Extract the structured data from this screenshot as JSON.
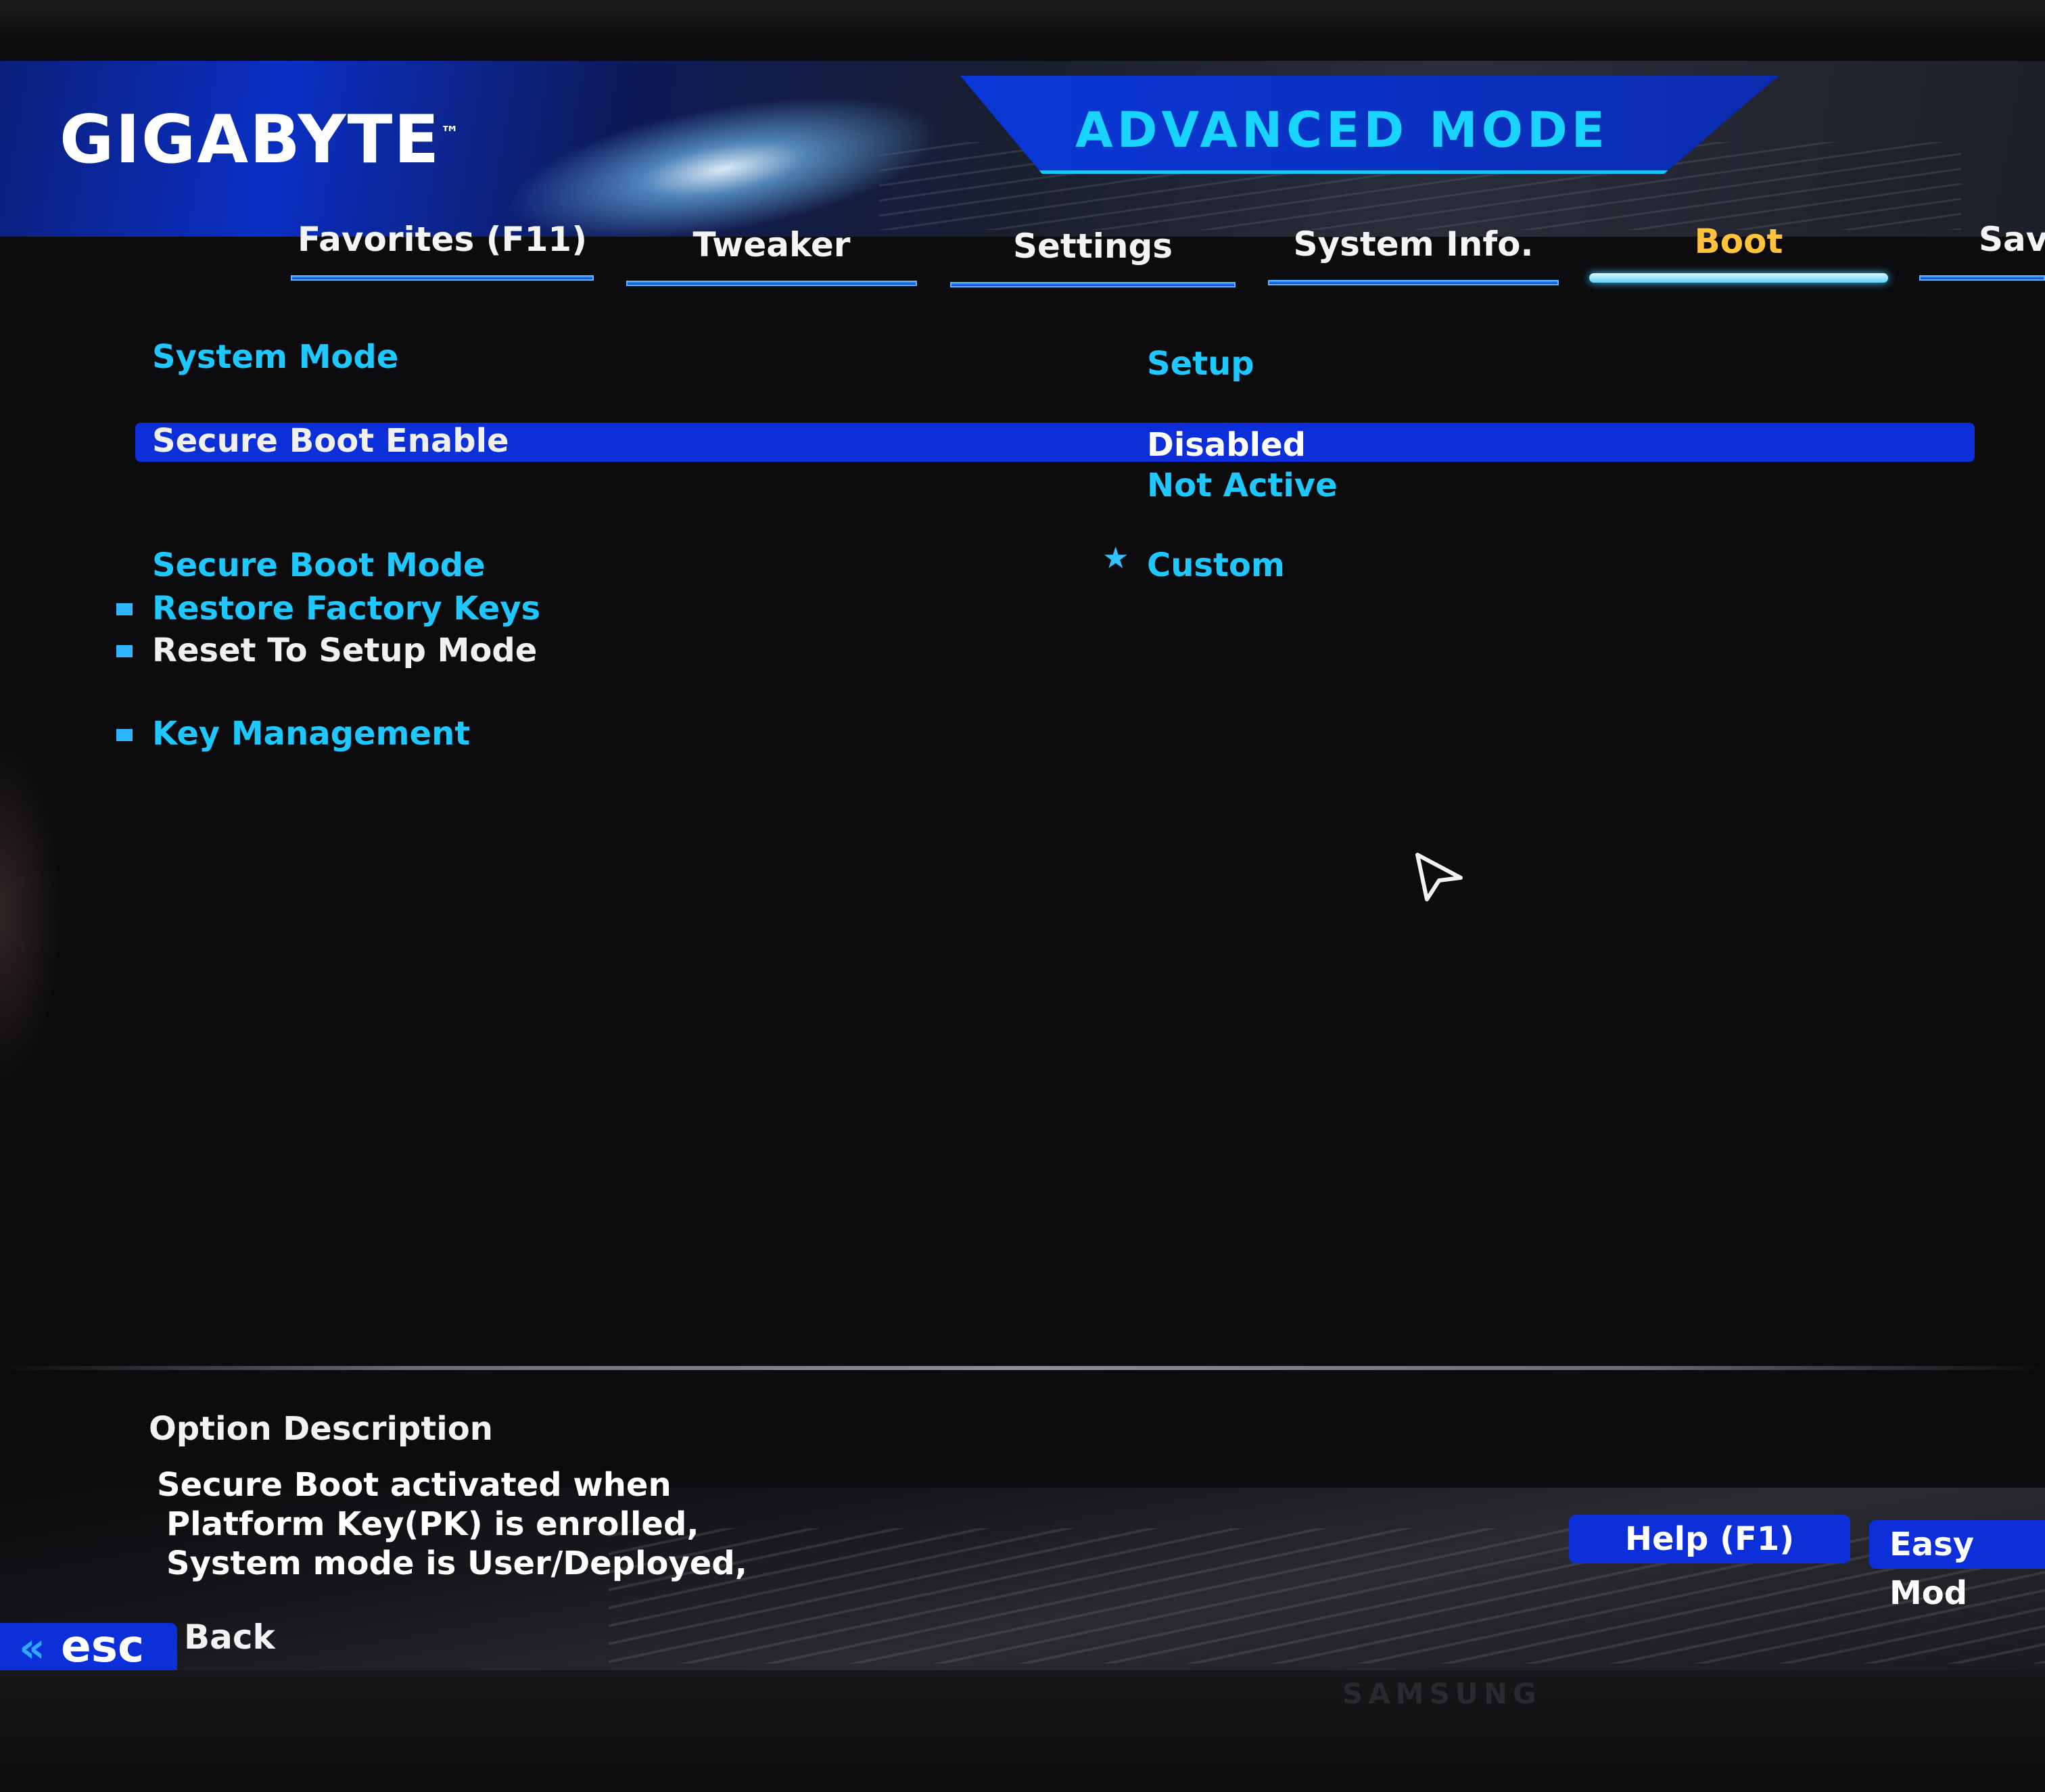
{
  "header": {
    "brand": "GIGABYTE",
    "trademark": "™",
    "mode_title": "ADVANCED MODE"
  },
  "tabs": [
    {
      "label": "Favorites (F11)",
      "active": false
    },
    {
      "label": "Tweaker",
      "active": false
    },
    {
      "label": "Settings",
      "active": false
    },
    {
      "label": "System Info.",
      "active": false
    },
    {
      "label": "Boot",
      "active": true
    },
    {
      "label": "Save",
      "active": false
    }
  ],
  "settings": {
    "system_mode": {
      "label": "System Mode",
      "value": "Setup"
    },
    "secure_boot_enable": {
      "label": "Secure Boot Enable",
      "value": "Disabled",
      "status": "Not Active"
    },
    "secure_boot_mode": {
      "label": "Secure Boot Mode",
      "value": "Custom"
    },
    "restore_factory_keys": {
      "label": "Restore Factory Keys"
    },
    "reset_to_setup_mode": {
      "label": "Reset To Setup Mode"
    },
    "key_management": {
      "label": "Key Management"
    }
  },
  "description": {
    "title": "Option Description",
    "lines": [
      "Secure Boot activated when",
      "Platform Key(PK) is enrolled,",
      "System mode is User/Deployed,"
    ]
  },
  "footer": {
    "help_label": "Help (F1)",
    "easy_mode_label": "Easy Mod",
    "esc_chevron": "«",
    "esc_label": "esc",
    "back_label": "Back",
    "monitor_brand": "SAMSUNG"
  },
  "colors": {
    "accent_cyan": "#1fc7ff",
    "selection_blue": "#0d2fd9",
    "active_tab": "#ffc23a"
  },
  "icons": {
    "cursor": "mouse-pointer-icon",
    "selected_marker": "star-icon",
    "submenu_bullet": "square-bullet-icon"
  }
}
